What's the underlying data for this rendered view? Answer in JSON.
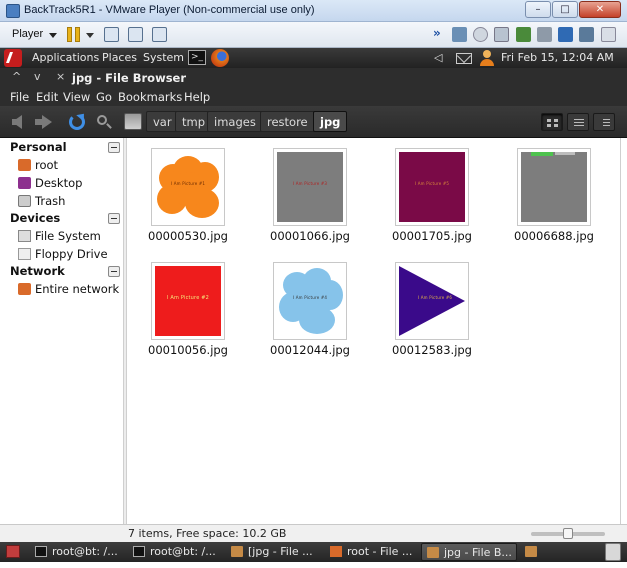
{
  "window": {
    "title": "BackTrack5R1 - VMware Player (Non-commercial use only)",
    "buttons": {
      "minimize": "–",
      "maximize": "□",
      "close": "✕"
    }
  },
  "vmware": {
    "player_label": "Player",
    "overflow": "»"
  },
  "gnome_panel": {
    "menus": [
      "Applications",
      "Places",
      "System"
    ],
    "clock": "Fri Feb 15, 12:04 AM",
    "terminal_glyph": ">_"
  },
  "nautilus": {
    "controls": [
      "^",
      "v",
      "×"
    ],
    "title": "jpg - File Browser",
    "menu": [
      "File",
      "Edit",
      "View",
      "Go",
      "Bookmarks",
      "Help"
    ],
    "breadcrumbs": [
      "var",
      "tmp",
      "images",
      "restore",
      "jpg"
    ]
  },
  "sidebar": {
    "sections": [
      {
        "title": "Personal",
        "items": [
          {
            "label": "root",
            "icon": "home-folder-icon"
          },
          {
            "label": "Desktop",
            "icon": "desktop-icon"
          },
          {
            "label": "Trash",
            "icon": "trash-icon"
          }
        ]
      },
      {
        "title": "Devices",
        "items": [
          {
            "label": "File System",
            "icon": "harddisk-icon"
          },
          {
            "label": "Floppy Drive",
            "icon": "floppy-icon"
          }
        ]
      },
      {
        "title": "Network",
        "items": [
          {
            "label": "Entire network",
            "icon": "network-icon"
          }
        ]
      }
    ]
  },
  "files": [
    {
      "name": "00000530.jpg",
      "caption": "I Am Picture #1",
      "style": "orange-cloud"
    },
    {
      "name": "00001066.jpg",
      "caption": "I Am Picture #3",
      "style": "grey"
    },
    {
      "name": "00001705.jpg",
      "caption": "I Am Picture #5",
      "style": "maroon"
    },
    {
      "name": "00006688.jpg",
      "caption": "",
      "style": "grey-partial"
    },
    {
      "name": "00010056.jpg",
      "caption": "I Am Picture #2",
      "style": "red"
    },
    {
      "name": "00012044.jpg",
      "caption": "I Am Picture #4",
      "style": "blue-cloud"
    },
    {
      "name": "00012583.jpg",
      "caption": "I Am Picture #6",
      "style": "navy-triangle"
    }
  ],
  "status": {
    "text": "7 items, Free space: 10.2 GB",
    "zoom_fraction": 0.5
  },
  "taskbar": {
    "tasks": [
      {
        "label": "root@bt: /...",
        "icon": "terminal-icon",
        "active": false
      },
      {
        "label": "root@bt: /...",
        "icon": "terminal-icon",
        "active": false
      },
      {
        "label": "[jpg - File ...",
        "icon": "folder-icon",
        "active": false
      },
      {
        "label": "root - File ...",
        "icon": "home-folder-icon",
        "active": false
      },
      {
        "label": "jpg - File B...",
        "icon": "folder-icon",
        "active": true
      }
    ]
  },
  "colors": {
    "orange": "#f7871c",
    "grey": "#7d7d7d",
    "maroon": "#7a0a47",
    "red": "#ee1c1c",
    "light_blue": "#86c3ea",
    "navy": "#3a0a8a"
  }
}
